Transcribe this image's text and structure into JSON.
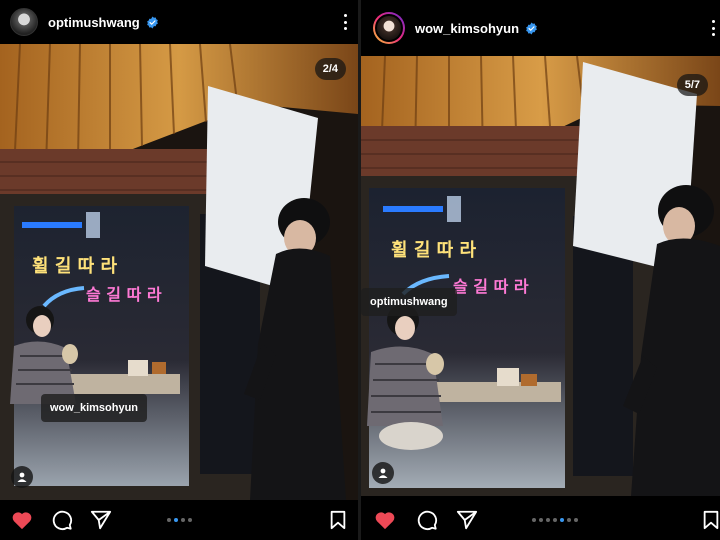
{
  "posts": [
    {
      "username": "optimushwang",
      "counter": "2/4",
      "tag": "wow_kimsohyun",
      "sign_line1": "휠 길 따 라",
      "sign_line2": "슬 길 따 라",
      "carousel": {
        "count": 4,
        "active": 1
      }
    },
    {
      "username": "wow_kimsohyun",
      "counter": "5/7",
      "tag": "optimushwang",
      "sign_line1": "휠 길 따 라",
      "sign_line2": "슬 길 따 라",
      "carousel": {
        "count": 7,
        "active": 4
      }
    }
  ],
  "icons": {
    "verified": "verified-badge-icon",
    "more": "more-options-icon",
    "like": "heart-icon",
    "comment": "comment-icon",
    "share": "send-icon",
    "save": "bookmark-icon",
    "tagged": "user-tag-icon"
  },
  "colors": {
    "verified": "#3897f0",
    "like": "#ed4956",
    "dot_active": "#3897f0",
    "dot_inactive": "#666666"
  }
}
